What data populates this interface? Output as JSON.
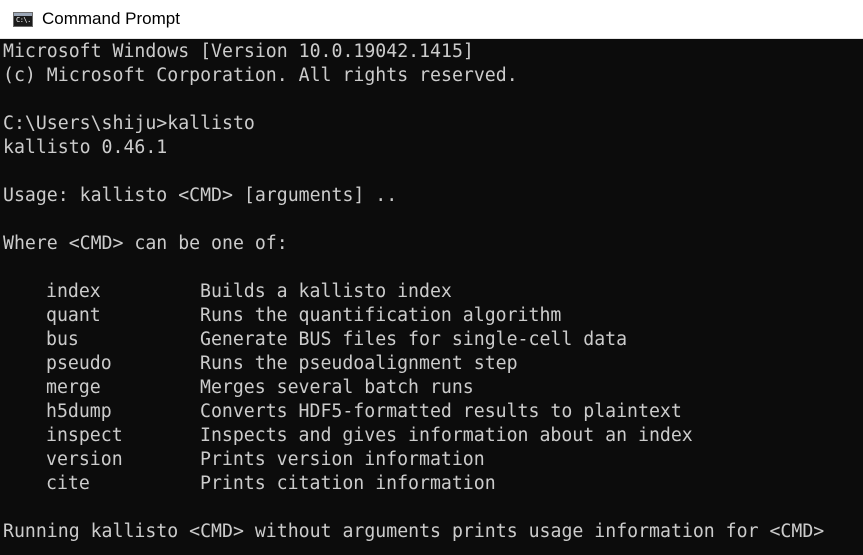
{
  "window": {
    "title": "Command Prompt",
    "icon": "cmd-icon",
    "icon_text": "C:\\."
  },
  "console": {
    "lines_top": [
      "Microsoft Windows [Version 10.0.19042.1415]",
      "(c) Microsoft Corporation. All rights reserved.",
      "",
      "C:\\Users\\shiju>kallisto",
      "kallisto 0.46.1",
      "",
      "Usage: kallisto <CMD> [arguments] ..",
      "",
      "Where <CMD> can be one of:",
      ""
    ],
    "commands": [
      {
        "name": "index",
        "desc": "Builds a kallisto index"
      },
      {
        "name": "quant",
        "desc": "Runs the quantification algorithm"
      },
      {
        "name": "bus",
        "desc": "Generate BUS files for single-cell data"
      },
      {
        "name": "pseudo",
        "desc": "Runs the pseudoalignment step"
      },
      {
        "name": "merge",
        "desc": "Merges several batch runs"
      },
      {
        "name": "h5dump",
        "desc": "Converts HDF5-formatted results to plaintext"
      },
      {
        "name": "inspect",
        "desc": "Inspects and gives information about an index"
      },
      {
        "name": "version",
        "desc": "Prints version information"
      },
      {
        "name": "cite",
        "desc": "Prints citation information"
      }
    ],
    "lines_bottom": [
      "",
      "Running kallisto <CMD> without arguments prints usage information for <CMD>"
    ]
  },
  "colors": {
    "console_background": "#0c0c0c",
    "console_text": "#cccccc",
    "titlebar_background": "#ffffff",
    "titlebar_text": "#000000"
  }
}
